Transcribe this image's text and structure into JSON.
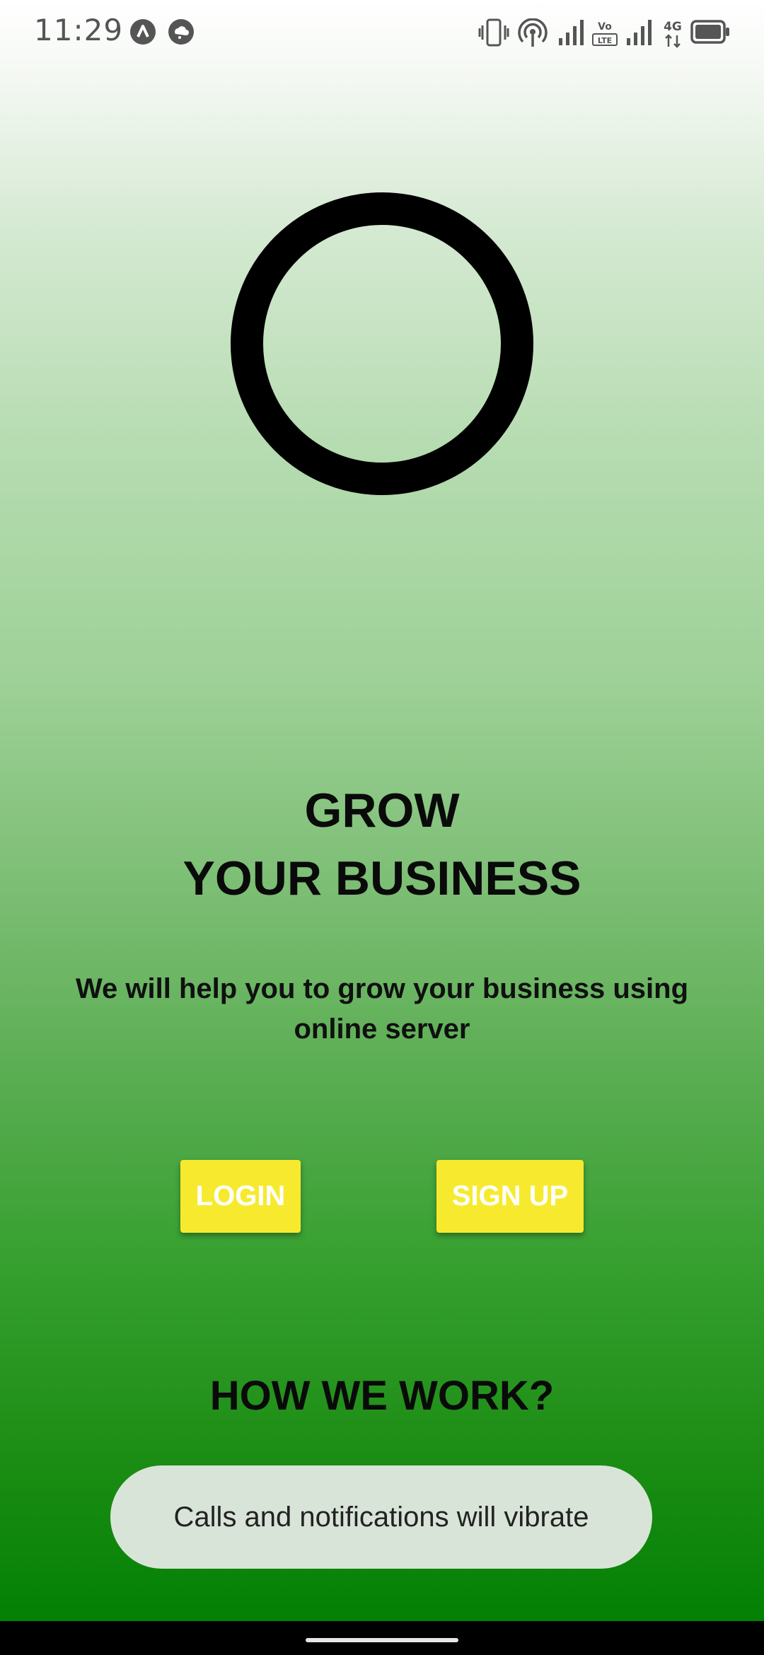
{
  "status_bar": {
    "time": "11:29",
    "left_icons": [
      "app-notification-icon",
      "cloud-notification-icon"
    ],
    "right_icons": [
      "vibrate-icon",
      "hotspot-icon",
      "signal-icon",
      "volte-icon",
      "signal-icon",
      "4g-icon",
      "battery-icon"
    ],
    "volte_label": "Vo LTE",
    "network_label": "4G"
  },
  "hero": {
    "title_line1": "GROW",
    "title_line2": "YOUR BUSINESS",
    "subtitle": "We will help you to grow your business using online server"
  },
  "actions": {
    "login_label": "LOGIN",
    "signup_label": "SIGN UP",
    "button_color": "#f7ea2e"
  },
  "section": {
    "how_we_work": "HOW WE WORK?"
  },
  "toast": {
    "message": "Calls and notifications will vibrate"
  },
  "theme": {
    "gradient_top": "#ffffff",
    "gradient_bottom": "#038104"
  }
}
